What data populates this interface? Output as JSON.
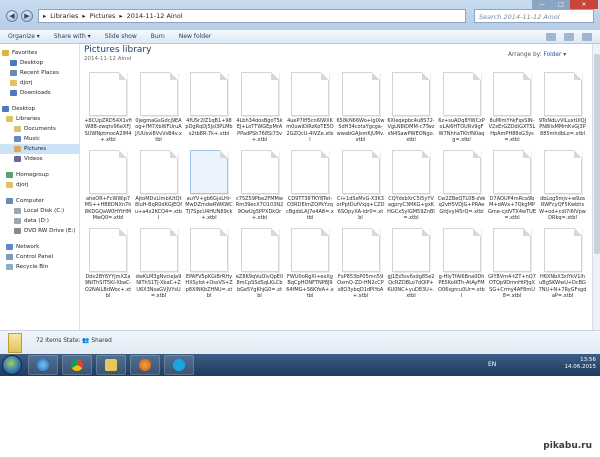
{
  "address": {
    "parts": [
      "Libraries",
      "Pictures",
      "2014-11-12 Ainol"
    ]
  },
  "search": {
    "placeholder": "Search 2014-11-12 Ainol"
  },
  "toolbar": {
    "organize": "Organize ▾",
    "share": "Share with ▾",
    "slideshow": "Slide show",
    "burn": "Burn",
    "new_folder": "New folder"
  },
  "nav": {
    "items": [
      {
        "label": "Favorites",
        "icon": "star-icon",
        "color": "#e0b43a"
      },
      {
        "label": "Desktop",
        "icon": "desktop-icon",
        "color": "#4a7ab8"
      },
      {
        "label": "Recent Places",
        "icon": "recent-icon",
        "color": "#6a8ab0"
      },
      {
        "label": "djorj",
        "icon": "user-folder-icon",
        "color": "#e2c25a"
      },
      {
        "label": "Downloads",
        "icon": "downloads-icon",
        "color": "#4a7ab8"
      },
      {
        "label": "Desktop",
        "icon": "desktop-icon",
        "color": "#4a7ab8"
      },
      {
        "label": "Libraries",
        "icon": "library-icon",
        "color": "#e2c25a"
      },
      {
        "label": "Documents",
        "icon": "documents-icon",
        "color": "#d8c07a"
      },
      {
        "label": "Music",
        "icon": "music-icon",
        "color": "#5a8ac8"
      },
      {
        "label": "Pictures",
        "icon": "pictures-icon",
        "color": "#d8a85a"
      },
      {
        "label": "Videos",
        "icon": "videos-icon",
        "color": "#6a6a9a"
      },
      {
        "label": "Homegroup",
        "icon": "homegroup-icon",
        "color": "#5aa06a"
      },
      {
        "label": "djorj",
        "icon": "user-folder-icon",
        "color": "#e2c25a"
      },
      {
        "label": "Computer",
        "icon": "computer-icon",
        "color": "#6a8ab0"
      },
      {
        "label": "Local Disk (C:)",
        "icon": "disk-icon",
        "color": "#9aa6b4"
      },
      {
        "label": "data (D:)",
        "icon": "disk-icon",
        "color": "#9aa6b4"
      },
      {
        "label": "DVD RW Drive (E:)",
        "icon": "dvd-icon",
        "color": "#8a8a8a"
      },
      {
        "label": "Network",
        "icon": "network-icon",
        "color": "#5a8ac8"
      },
      {
        "label": "Control Panel",
        "icon": "control-panel-icon",
        "color": "#7a9ac0"
      },
      {
        "label": "Recycle Bin",
        "icon": "recycle-bin-icon",
        "color": "#8ab0c8"
      }
    ]
  },
  "library": {
    "title": "Pictures library",
    "subtitle": "2014-11-12 Ainol",
    "arrange_label": "Arrange by:",
    "arrange_value": "Folder ▾"
  },
  "files": [
    "+8CUpZRD54X1vfiW8B-zwqtv96eXFJSUWNptmocA2lM4+.xtbl",
    "0jegmaGsGdcj9EAog+fM7XbWFUruAJ/UUsvi8VvVsB4v.xtbl",
    "4fUSr2IZ1qB1+98pDgRqDj5Jsl3PLMbs2tb8R-7k+.xtbl",
    "4Lbh34dosBgoT5kEJ+LoTTWGEpMrAPPadPSh768Si73v+.xtbl",
    "4ueP7Iff5cn6lWXKm0uwiDiRzKoTE5O2GZQcU-4IVZe.xtbl",
    "658kN66Wo+lgIXw5dH34cotaYgcga-wwabGAJsmKjUMv.xtbl",
    "6Xleqepbc4u8S72-VgLN8IDMM-c7TwzsN4SawPWEONgo.xtbl",
    "6z+suADq8YWCzPoLAi6HTOURv9gFW7NhhaTKhfN0aqg=.xtbl",
    "8uMImYhkFqsSIN-V2xErGZDdiGXT5LHpAmPH88sG3ys=.xtbl",
    "9ToNdLvVlLuxtUlQJPN8ilsMMmKvGj3P885mhdbLo=.xtbl",
    "aheOR+FcWWip7MS++HB8DNXn7h8KDGQaW0HYtHMMwQ0=.xtbl",
    "AjtoMDvLImbiUtQt8luH-BqR0dKGjEQfu+a4x2KCQ4=.xtbl",
    "auYV+gb6GjxLHr-MwDZmdwRWKWCTJ7SpcU4HUN89ck+.xtbl",
    "c75Z59Pbe2FMMwRm39ecX7O103N29OwUg5PPXDkQr+.xtbl",
    "CD9TT36TKY8Tet-O3RDElmZQPkYzqcBgdzLAJ7e4A8=.xtbl",
    "Ci+1dSsMvG-X3K3orPptDufVxjq+CZD6SOpyXA-idr0=.xtbl",
    "CQYdsbXrC5i5yYVagpryC3MKG+gxKHGCx5yIGM59ZnBl=.xtbl",
    "Cw2ZBeQTL0B-zVeq2vH5VDJG+PRAeGttJvyI45rQ=.xtbl",
    "D7AOUP4mRca9bM+dAVx+7QkgMPGme-cjdVTX4wTUE=.xtbl",
    "dbLog5mjv+w9zaRWFcyQF5KwbhsW+od+cdi7i6lVpwDRkq=.xtbl",
    "Ddv2BY6YYjmXZa9NIThSlT5Kl-XbaC-O2NAlLBdWoc+.xtbl",
    "dwKLM3gNvcieJa9NIThS1TJ-XbaC+ZU6X3NsaGVJVYsU=.xtbl",
    "EPAFV5pKGiBrRHyHXSyIot+OssVS+Zp8XINKbZHNU=.xtbl",
    "eZ8K9qVuOlvQpE08mCpSSdSqLKLCbbGe5YgKhjG0=.xtbl",
    "FWU0oRgXl+exXgBqCpHONFTNP8J964fMG+S6KYoA+.xtbl",
    "FxP853bP05mn59OxmQ-ZD-HN2cCPs8O3ybqD1dPlYoA+.xtbl",
    "gj1Es5sv6sdg85e2QcRZDBLo7dQlP+KU0NC+yuD83U+.xtbl",
    "g-HIyTfAl6Bna0DhPE5KolKTh-AtAyFMO06sgrcu0Ur=.xtbl",
    "GIY8Vm4-tZT+nQ7OTQp9DmnHtPJqXSG+Crmy4AF8mU8=.xtbl",
    "H6XNbX3zlYkV1lhuBgSKWwU+DcBG7NU+N+7RyGFsgdaP=.xtbl"
  ],
  "selected_file_index": 12,
  "status": {
    "count": "72 items",
    "state_label": "State:",
    "state_value": "Shared"
  },
  "taskbar": {
    "lang": "EN",
    "time": "13:56",
    "date": "14.06.2015"
  },
  "watermark": "pikabu.ru"
}
